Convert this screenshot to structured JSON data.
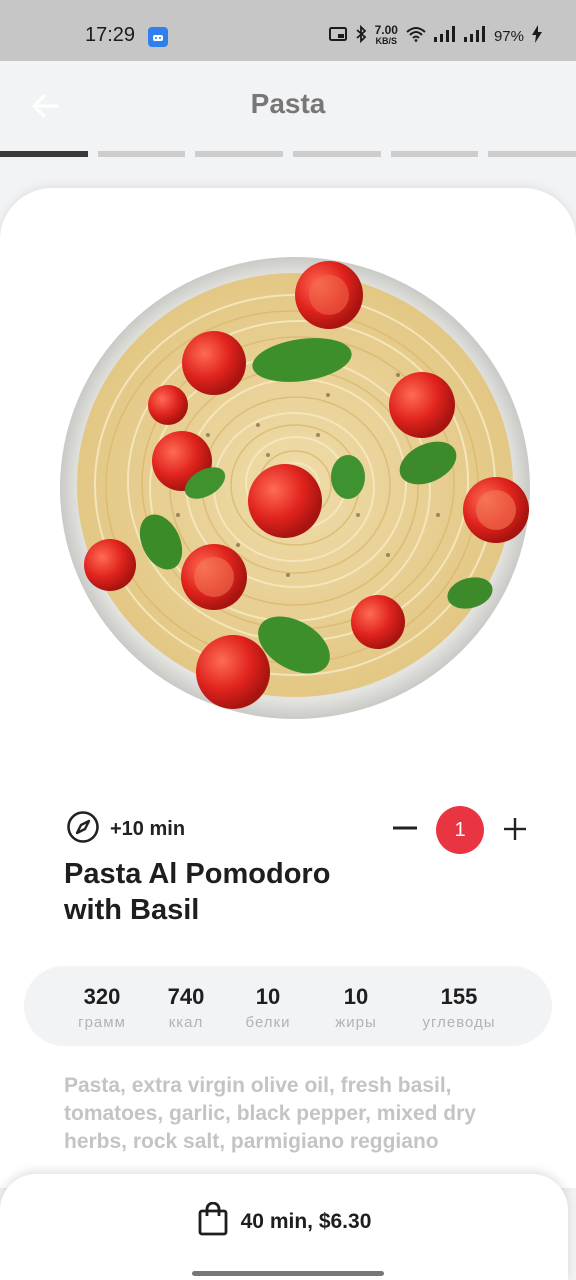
{
  "status_bar": {
    "time": "17:29",
    "speed_value": "7.00",
    "speed_unit": "KB/S",
    "battery": "97%"
  },
  "header": {
    "title": "Pasta",
    "progress": {
      "segments": 6,
      "active_index": 0
    }
  },
  "dish": {
    "image": "spaghetti-with-tomatoes-and-basil",
    "extra_time": "+10 min",
    "name": "Pasta Al Pomodoro with Basil",
    "quantity": "1",
    "minus_label": "−",
    "plus_label": "+"
  },
  "nutrition": [
    {
      "value": "320",
      "label": "грамм"
    },
    {
      "value": "740",
      "label": "ккал"
    },
    {
      "value": "10",
      "label": "белки"
    },
    {
      "value": "10",
      "label": "жиры"
    },
    {
      "value": "155",
      "label": "углеводы"
    }
  ],
  "ingredients": "Pasta, extra virgin olive oil, fresh basil, tomatoes, garlic, black pepper, mixed dry herbs, rock salt, parmigiano reggiano",
  "order": {
    "label": "40 min, $6.30"
  },
  "colors": {
    "accent": "#e93442",
    "active_segment": "#3a3a3a",
    "inactive_segment": "#cdcdcd",
    "muted_text": "#c4c4c4"
  }
}
